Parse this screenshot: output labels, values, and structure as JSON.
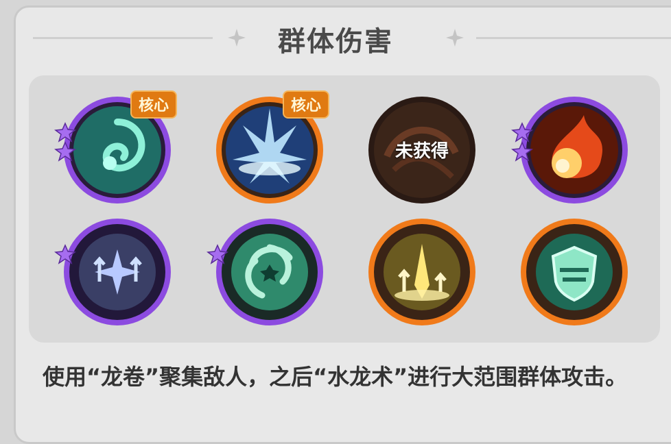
{
  "header": {
    "title": "群体伤害"
  },
  "skills": [
    {
      "id": "vortex",
      "rarity": "purple",
      "badge": "核心",
      "stars": 2,
      "icon": "vortex-icon"
    },
    {
      "id": "ice-burst",
      "rarity": "orange",
      "badge": "核心",
      "stars": 0,
      "icon": "ice-burst-icon"
    },
    {
      "id": "locked",
      "rarity": "dark",
      "badge": "",
      "stars": 0,
      "icon": "locked-icon",
      "locked_label": "未获得"
    },
    {
      "id": "fireball",
      "rarity": "purple",
      "badge": "",
      "stars": 2,
      "icon": "fireball-icon"
    },
    {
      "id": "arrows",
      "rarity": "purple",
      "badge": "",
      "stars": 1,
      "icon": "arrows-up-icon"
    },
    {
      "id": "wind",
      "rarity": "purple",
      "badge": "",
      "stars": 1,
      "icon": "wind-burst-icon"
    },
    {
      "id": "light",
      "rarity": "orange",
      "badge": "",
      "stars": 0,
      "icon": "light-beam-icon"
    },
    {
      "id": "shield",
      "rarity": "orange",
      "badge": "",
      "stars": 0,
      "icon": "shield-icon"
    }
  ],
  "description": "使用“龙卷”聚集敌人，之后“水龙术”进行大范围群体攻击。",
  "colors": {
    "purple_ring": "#8c4be0",
    "orange_ring": "#f07a1a",
    "badge_bg": "#e07a12",
    "panel_bg": "#e8e8e8",
    "tray_bg": "#d9d9d9"
  }
}
